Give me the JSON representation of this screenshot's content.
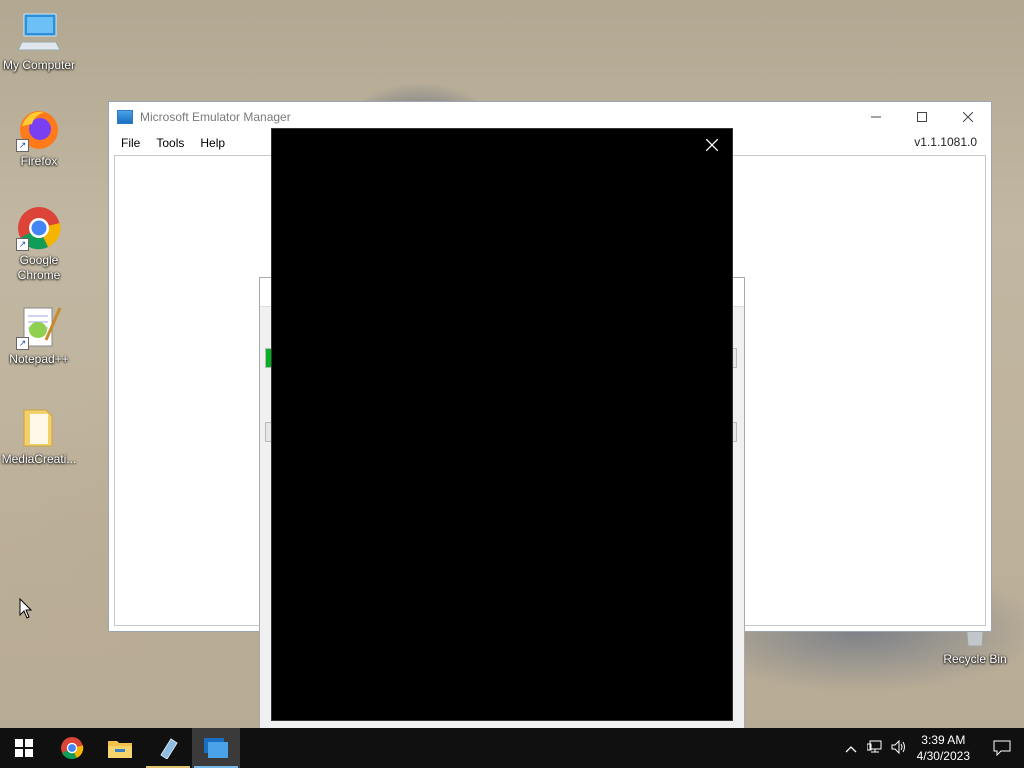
{
  "desktop": {
    "icons": [
      {
        "label": "My Computer"
      },
      {
        "label": "Firefox"
      },
      {
        "label": "Google Chrome"
      },
      {
        "label": "Notepad++"
      },
      {
        "label": "MediaCreati..."
      },
      {
        "label": "Recycle Bin"
      }
    ]
  },
  "window": {
    "title": "Microsoft Emulator Manager",
    "menu": [
      "File",
      "Tools",
      "Help"
    ],
    "version": "v1.1.1081.0"
  },
  "taskbar": {
    "time": "3:39 AM",
    "date": "4/30/2023"
  }
}
